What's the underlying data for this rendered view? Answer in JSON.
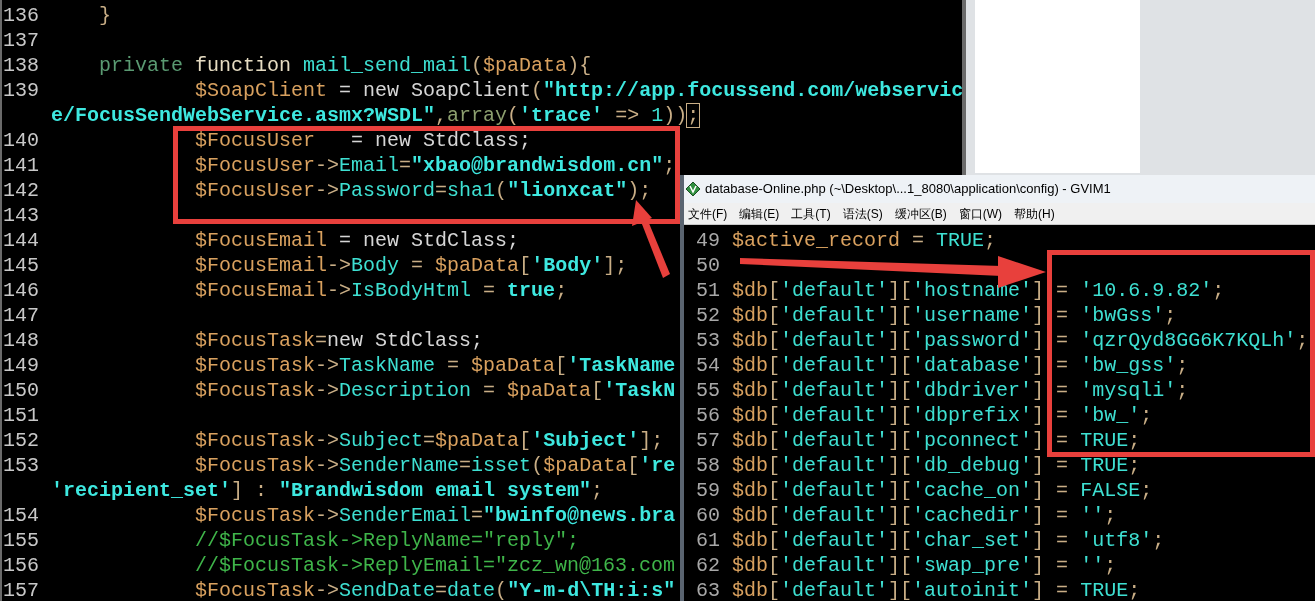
{
  "left_editor": {
    "lines": [
      {
        "number": "136",
        "tokens": [
          {
            "kind": "op",
            "text": "    }"
          }
        ]
      },
      {
        "number": "137"
      },
      {
        "number": "138",
        "tokens": [
          {
            "kind": "kw",
            "text": "    private "
          },
          {
            "kind": "fn",
            "text": "function "
          },
          {
            "kind": "prop",
            "text": "mail_send_mail"
          },
          {
            "kind": "op",
            "text": "("
          },
          {
            "kind": "var",
            "text": "$paData"
          },
          {
            "kind": "op",
            "text": "){"
          }
        ]
      },
      {
        "number": "139",
        "tokens": [
          {
            "kind": "var",
            "text": "            $SoapClient"
          },
          {
            "kind": "plain",
            "text": " = new SoapClient"
          },
          {
            "kind": "op",
            "text": "("
          },
          {
            "kind": "str",
            "text": "\"http://app.focussend.com/webservic"
          }
        ]
      },
      {
        "tokens": [
          {
            "kind": "str",
            "text": "e/FocusSendWebService.asmx?WSDL\""
          },
          {
            "kind": "op",
            "text": ","
          },
          {
            "kind": "arr",
            "text": "array"
          },
          {
            "kind": "op",
            "text": "("
          },
          {
            "kind": "str",
            "text": "'trace'"
          },
          {
            "kind": "op",
            "text": " => "
          },
          {
            "kind": "num",
            "text": "1"
          },
          {
            "kind": "op",
            "text": "))"
          },
          {
            "kind": "cursor",
            "text": ";"
          }
        ]
      },
      {
        "number": "140",
        "tokens": [
          {
            "kind": "var",
            "text": "            $FocusUser"
          },
          {
            "kind": "plain",
            "text": "   = new StdClass;"
          }
        ]
      },
      {
        "number": "141",
        "tokens": [
          {
            "kind": "var",
            "text": "            $FocusUser"
          },
          {
            "kind": "op",
            "text": "->"
          },
          {
            "kind": "prop",
            "text": "Email"
          },
          {
            "kind": "op",
            "text": "="
          },
          {
            "kind": "str",
            "text": "\"xbao@brandwisdom.cn\""
          },
          {
            "kind": "op",
            "text": ";"
          }
        ]
      },
      {
        "number": "142",
        "tokens": [
          {
            "kind": "var",
            "text": "            $FocusUser"
          },
          {
            "kind": "op",
            "text": "->"
          },
          {
            "kind": "prop",
            "text": "Password"
          },
          {
            "kind": "op",
            "text": "="
          },
          {
            "kind": "prop",
            "text": "sha1"
          },
          {
            "kind": "op",
            "text": "("
          },
          {
            "kind": "str",
            "text": "\"lionxcat\""
          },
          {
            "kind": "op",
            "text": ");"
          }
        ]
      },
      {
        "number": "143"
      },
      {
        "number": "144",
        "tokens": [
          {
            "kind": "var",
            "text": "            $FocusEmail"
          },
          {
            "kind": "plain",
            "text": " = new StdClass;"
          }
        ]
      },
      {
        "number": "145",
        "tokens": [
          {
            "kind": "var",
            "text": "            $FocusEmail"
          },
          {
            "kind": "op",
            "text": "->"
          },
          {
            "kind": "prop",
            "text": "Body"
          },
          {
            "kind": "op",
            "text": " = "
          },
          {
            "kind": "var",
            "text": "$paData"
          },
          {
            "kind": "op",
            "text": "["
          },
          {
            "kind": "str",
            "text": "'Body'"
          },
          {
            "kind": "op",
            "text": "];"
          }
        ]
      },
      {
        "number": "146",
        "tokens": [
          {
            "kind": "var",
            "text": "            $FocusEmail"
          },
          {
            "kind": "op",
            "text": "->"
          },
          {
            "kind": "prop",
            "text": "IsBodyHtml"
          },
          {
            "kind": "op",
            "text": " = "
          },
          {
            "kind": "str",
            "text": "true"
          },
          {
            "kind": "op",
            "text": ";"
          }
        ]
      },
      {
        "number": "147"
      },
      {
        "number": "148",
        "tokens": [
          {
            "kind": "var",
            "text": "            $FocusTask"
          },
          {
            "kind": "op",
            "text": "="
          },
          {
            "kind": "plain",
            "text": "new StdClass;"
          }
        ]
      },
      {
        "number": "149",
        "tokens": [
          {
            "kind": "var",
            "text": "            $FocusTask"
          },
          {
            "kind": "op",
            "text": "->"
          },
          {
            "kind": "prop",
            "text": "TaskName"
          },
          {
            "kind": "op",
            "text": " = "
          },
          {
            "kind": "var",
            "text": "$paData"
          },
          {
            "kind": "op",
            "text": "["
          },
          {
            "kind": "str",
            "text": "'TaskName"
          }
        ]
      },
      {
        "number": "150",
        "tokens": [
          {
            "kind": "var",
            "text": "            $FocusTask"
          },
          {
            "kind": "op",
            "text": "->"
          },
          {
            "kind": "prop",
            "text": "Description"
          },
          {
            "kind": "op",
            "text": " = "
          },
          {
            "kind": "var",
            "text": "$paData"
          },
          {
            "kind": "op",
            "text": "["
          },
          {
            "kind": "str",
            "text": "'TaskN"
          }
        ]
      },
      {
        "number": "151"
      },
      {
        "number": "152",
        "tokens": [
          {
            "kind": "var",
            "text": "            $FocusTask"
          },
          {
            "kind": "op",
            "text": "->"
          },
          {
            "kind": "prop",
            "text": "Subject"
          },
          {
            "kind": "op",
            "text": "="
          },
          {
            "kind": "var",
            "text": "$paData"
          },
          {
            "kind": "op",
            "text": "["
          },
          {
            "kind": "str",
            "text": "'Subject'"
          },
          {
            "kind": "op",
            "text": "];"
          }
        ]
      },
      {
        "number": "153",
        "tokens": [
          {
            "kind": "var",
            "text": "            $FocusTask"
          },
          {
            "kind": "op",
            "text": "->"
          },
          {
            "kind": "prop",
            "text": "SenderName"
          },
          {
            "kind": "op",
            "text": "="
          },
          {
            "kind": "prop",
            "text": "isset"
          },
          {
            "kind": "op",
            "text": "("
          },
          {
            "kind": "var",
            "text": "$paData"
          },
          {
            "kind": "op",
            "text": "["
          },
          {
            "kind": "str",
            "text": "'re"
          }
        ]
      },
      {
        "tokens": [
          {
            "kind": "str",
            "text": "'recipient_set'"
          },
          {
            "kind": "op",
            "text": "] : "
          },
          {
            "kind": "str",
            "text": "\"Brandwisdom email system\""
          },
          {
            "kind": "op",
            "text": ";"
          }
        ]
      },
      {
        "number": "154",
        "tokens": [
          {
            "kind": "var",
            "text": "            $FocusTask"
          },
          {
            "kind": "op",
            "text": "->"
          },
          {
            "kind": "prop",
            "text": "SenderEmail"
          },
          {
            "kind": "op",
            "text": "="
          },
          {
            "kind": "str",
            "text": "\"bwinfo@news.bra"
          }
        ]
      },
      {
        "number": "155",
        "tokens": [
          {
            "kind": "cmt",
            "text": "            //$FocusTask->ReplyName=\"reply\";"
          }
        ]
      },
      {
        "number": "156",
        "tokens": [
          {
            "kind": "cmt",
            "text": "            //$FocusTask->ReplyEmail=\"zcz_wn@163.com"
          }
        ]
      },
      {
        "number": "157",
        "tokens": [
          {
            "kind": "var",
            "text": "            $FocusTask"
          },
          {
            "kind": "op",
            "text": "->"
          },
          {
            "kind": "prop",
            "text": "SendDate"
          },
          {
            "kind": "op",
            "text": "="
          },
          {
            "kind": "prop",
            "text": "date"
          },
          {
            "kind": "op",
            "text": "("
          },
          {
            "kind": "str",
            "text": "\"Y-m-d\\TH:i:s\""
          }
        ]
      }
    ]
  },
  "right_editor": {
    "window": {
      "title": "database-Online.php (~\\Desktop\\...1_8080\\application\\config) - GVIM1"
    },
    "menu": [
      "文件(F)",
      "编辑(E)",
      "工具(T)",
      "语法(S)",
      "缓冲区(B)",
      "窗口(W)",
      "帮助(H)"
    ],
    "lines": [
      {
        "number": "49",
        "tokens": [
          {
            "kind": "var",
            "text": "$active_record"
          },
          {
            "kind": "op",
            "text": " = "
          },
          {
            "kind": "key",
            "text": "TRUE"
          },
          {
            "kind": "op",
            "text": ";"
          }
        ]
      },
      {
        "number": "50"
      },
      {
        "number": "51",
        "tokens": [
          {
            "kind": "var",
            "text": "$db"
          },
          {
            "kind": "op",
            "text": "["
          },
          {
            "kind": "key",
            "text": "'default'"
          },
          {
            "kind": "op",
            "text": "]["
          },
          {
            "kind": "key",
            "text": "'hostname'"
          },
          {
            "kind": "op",
            "text": "] = "
          },
          {
            "kind": "key",
            "text": "'10.6.9.82'"
          },
          {
            "kind": "op",
            "text": ";"
          }
        ]
      },
      {
        "number": "52",
        "tokens": [
          {
            "kind": "var",
            "text": "$db"
          },
          {
            "kind": "op",
            "text": "["
          },
          {
            "kind": "key",
            "text": "'default'"
          },
          {
            "kind": "op",
            "text": "]["
          },
          {
            "kind": "key",
            "text": "'username'"
          },
          {
            "kind": "op",
            "text": "] = "
          },
          {
            "kind": "key",
            "text": "'bwGss'"
          },
          {
            "kind": "op",
            "text": ";"
          }
        ]
      },
      {
        "number": "53",
        "tokens": [
          {
            "kind": "var",
            "text": "$db"
          },
          {
            "kind": "op",
            "text": "["
          },
          {
            "kind": "key",
            "text": "'default'"
          },
          {
            "kind": "op",
            "text": "]["
          },
          {
            "kind": "key",
            "text": "'password'"
          },
          {
            "kind": "op",
            "text": "] = "
          },
          {
            "kind": "key",
            "text": "'qzrQyd8GG6K7KQLh'"
          },
          {
            "kind": "op",
            "text": ";"
          }
        ]
      },
      {
        "number": "54",
        "tokens": [
          {
            "kind": "var",
            "text": "$db"
          },
          {
            "kind": "op",
            "text": "["
          },
          {
            "kind": "key",
            "text": "'default'"
          },
          {
            "kind": "op",
            "text": "]["
          },
          {
            "kind": "key",
            "text": "'database'"
          },
          {
            "kind": "op",
            "text": "] = "
          },
          {
            "kind": "key",
            "text": "'bw_gss'"
          },
          {
            "kind": "op",
            "text": ";"
          }
        ]
      },
      {
        "number": "55",
        "tokens": [
          {
            "kind": "var",
            "text": "$db"
          },
          {
            "kind": "op",
            "text": "["
          },
          {
            "kind": "key",
            "text": "'default'"
          },
          {
            "kind": "op",
            "text": "]["
          },
          {
            "kind": "key",
            "text": "'dbdriver'"
          },
          {
            "kind": "op",
            "text": "] = "
          },
          {
            "kind": "key",
            "text": "'mysqli'"
          },
          {
            "kind": "op",
            "text": ";"
          }
        ]
      },
      {
        "number": "56",
        "tokens": [
          {
            "kind": "var",
            "text": "$db"
          },
          {
            "kind": "op",
            "text": "["
          },
          {
            "kind": "key",
            "text": "'default'"
          },
          {
            "kind": "op",
            "text": "]["
          },
          {
            "kind": "key",
            "text": "'dbprefix'"
          },
          {
            "kind": "op",
            "text": "] = "
          },
          {
            "kind": "key",
            "text": "'bw_'"
          },
          {
            "kind": "op",
            "text": ";"
          }
        ]
      },
      {
        "number": "57",
        "tokens": [
          {
            "kind": "var",
            "text": "$db"
          },
          {
            "kind": "op",
            "text": "["
          },
          {
            "kind": "key",
            "text": "'default'"
          },
          {
            "kind": "op",
            "text": "]["
          },
          {
            "kind": "key",
            "text": "'pconnect'"
          },
          {
            "kind": "op",
            "text": "] = "
          },
          {
            "kind": "key",
            "text": "TRUE"
          },
          {
            "kind": "op",
            "text": ";"
          }
        ]
      },
      {
        "number": "58",
        "tokens": [
          {
            "kind": "var",
            "text": "$db"
          },
          {
            "kind": "op",
            "text": "["
          },
          {
            "kind": "key",
            "text": "'default'"
          },
          {
            "kind": "op",
            "text": "]["
          },
          {
            "kind": "key",
            "text": "'db_debug'"
          },
          {
            "kind": "op",
            "text": "] = "
          },
          {
            "kind": "key",
            "text": "TRUE"
          },
          {
            "kind": "op",
            "text": ";"
          }
        ]
      },
      {
        "number": "59",
        "tokens": [
          {
            "kind": "var",
            "text": "$db"
          },
          {
            "kind": "op",
            "text": "["
          },
          {
            "kind": "key",
            "text": "'default'"
          },
          {
            "kind": "op",
            "text": "]["
          },
          {
            "kind": "key",
            "text": "'cache_on'"
          },
          {
            "kind": "op",
            "text": "] = "
          },
          {
            "kind": "key",
            "text": "FALSE"
          },
          {
            "kind": "op",
            "text": ";"
          }
        ]
      },
      {
        "number": "60",
        "tokens": [
          {
            "kind": "var",
            "text": "$db"
          },
          {
            "kind": "op",
            "text": "["
          },
          {
            "kind": "key",
            "text": "'default'"
          },
          {
            "kind": "op",
            "text": "]["
          },
          {
            "kind": "key",
            "text": "'cachedir'"
          },
          {
            "kind": "op",
            "text": "] = "
          },
          {
            "kind": "key",
            "text": "''"
          },
          {
            "kind": "op",
            "text": ";"
          }
        ]
      },
      {
        "number": "61",
        "tokens": [
          {
            "kind": "var",
            "text": "$db"
          },
          {
            "kind": "op",
            "text": "["
          },
          {
            "kind": "key",
            "text": "'default'"
          },
          {
            "kind": "op",
            "text": "]["
          },
          {
            "kind": "key",
            "text": "'char_set'"
          },
          {
            "kind": "op",
            "text": "] = "
          },
          {
            "kind": "key",
            "text": "'utf8'"
          },
          {
            "kind": "op",
            "text": ";"
          }
        ]
      },
      {
        "number": "62",
        "tokens": [
          {
            "kind": "var",
            "text": "$db"
          },
          {
            "kind": "op",
            "text": "["
          },
          {
            "kind": "key",
            "text": "'default'"
          },
          {
            "kind": "op",
            "text": "]["
          },
          {
            "kind": "key",
            "text": "'swap_pre'"
          },
          {
            "kind": "op",
            "text": "] = "
          },
          {
            "kind": "key",
            "text": "''"
          },
          {
            "kind": "op",
            "text": ";"
          }
        ]
      },
      {
        "number": "63",
        "tokens": [
          {
            "kind": "var",
            "text": "$db"
          },
          {
            "kind": "op",
            "text": "["
          },
          {
            "kind": "key",
            "text": "'default'"
          },
          {
            "kind": "op",
            "text": "]["
          },
          {
            "kind": "key",
            "text": "'autoinit'"
          },
          {
            "kind": "op",
            "text": "] = "
          },
          {
            "kind": "key",
            "text": "TRUE"
          },
          {
            "kind": "op",
            "text": ";"
          }
        ]
      }
    ]
  }
}
